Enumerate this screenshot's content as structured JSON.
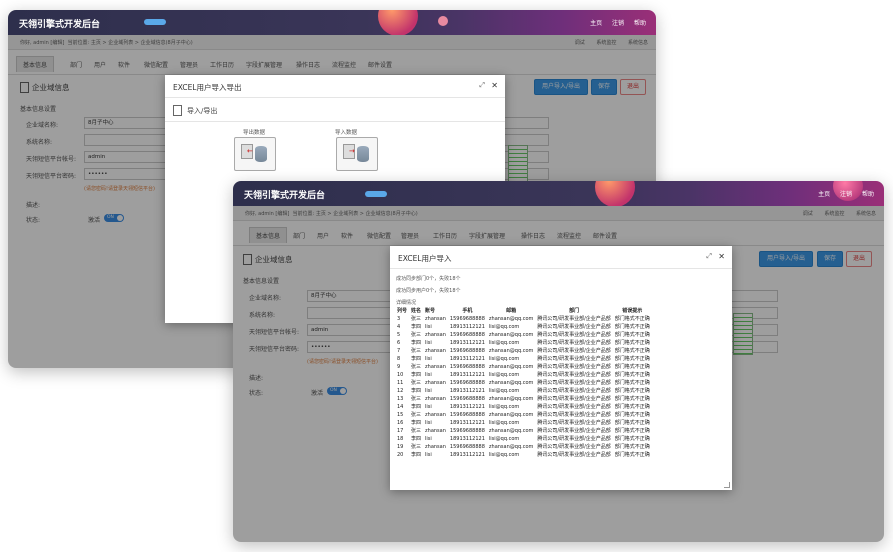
{
  "app": {
    "title": "天翎引擎式开发后台",
    "top_links": [
      "主页",
      "注销",
      "帮助"
    ]
  },
  "crumb": {
    "user": "你好, admin [编辑]",
    "location_label": "当前位置",
    "path": "主页 > 企业域列表 > 企业域信息(8月子中心)",
    "right_items": [
      "调试",
      "系统监控",
      "系统信息"
    ]
  },
  "tabs": [
    "基本信息",
    "部门",
    "用户",
    "软件",
    "微信配置",
    "管理员",
    "工作日历",
    "字段扩展管理",
    "操作日志",
    "流程监控",
    "邮件设置"
  ],
  "page": {
    "heading": "企业域信息",
    "section": "基本信息设置",
    "fields": [
      {
        "label": "企业域名称:",
        "value": "8月子中心"
      },
      {
        "label": "系统名称:",
        "value": ""
      },
      {
        "label": "天翎短信平台帐号:",
        "value": "admin"
      },
      {
        "label": "天翎短信平台密码:",
        "value": "••••••"
      }
    ],
    "warning": "(请您密码!请登录天翎短信平台)",
    "desc_label": "描述:",
    "status_label": "状态:",
    "status_value": "激活",
    "toggle": "ON",
    "buttons": {
      "import_export": "用户导入/导出",
      "save": "保存",
      "exit": "退出"
    }
  },
  "modal1": {
    "title": "EXCEL用户导入导出",
    "section": "导入/导出",
    "export_label": "导出数据",
    "import_label": "导入数据"
  },
  "modal2": {
    "title": "EXCEL用户导入",
    "success_dept": "成功同步部门0个，失败18个",
    "success_user": "成功同步用户0个，失败18个",
    "detail": "详细情况",
    "columns": [
      "列号",
      "姓名",
      "账号",
      "手机",
      "邮箱",
      "部门",
      "错误提示"
    ],
    "rows": [
      [
        "3",
        "张三",
        "zhansan",
        "15969688888",
        "zhansan@qq.com",
        "腾讯公司/研发事业部/企业产品部",
        "部门格式不正确"
      ],
      [
        "4",
        "李四",
        "lisi",
        "18913112121",
        "lisi@qq.com",
        "腾讯公司/研发事业部/企业产品部",
        "部门格式不正确"
      ],
      [
        "5",
        "张三",
        "zhansan",
        "15969688888",
        "zhansan@qq.com",
        "腾讯公司/研发事业部/企业产品部",
        "部门格式不正确"
      ],
      [
        "6",
        "李四",
        "lisi",
        "18913112121",
        "lisi@qq.com",
        "腾讯公司/研发事业部/企业产品部",
        "部门格式不正确"
      ],
      [
        "7",
        "张三",
        "zhansan",
        "15969688888",
        "zhansan@qq.com",
        "腾讯公司/研发事业部/企业产品部",
        "部门格式不正确"
      ],
      [
        "8",
        "李四",
        "lisi",
        "18913112121",
        "lisi@qq.com",
        "腾讯公司/研发事业部/企业产品部",
        "部门格式不正确"
      ],
      [
        "9",
        "张三",
        "zhansan",
        "15969688888",
        "zhansan@qq.com",
        "腾讯公司/研发事业部/企业产品部",
        "部门格式不正确"
      ],
      [
        "10",
        "李四",
        "lisi",
        "18913112121",
        "lisi@qq.com",
        "腾讯公司/研发事业部/企业产品部",
        "部门格式不正确"
      ],
      [
        "11",
        "张三",
        "zhansan",
        "15969688888",
        "zhansan@qq.com",
        "腾讯公司/研发事业部/企业产品部",
        "部门格式不正确"
      ],
      [
        "12",
        "李四",
        "lisi",
        "18913112121",
        "lisi@qq.com",
        "腾讯公司/研发事业部/企业产品部",
        "部门格式不正确"
      ],
      [
        "13",
        "张三",
        "zhansan",
        "15969688888",
        "zhansan@qq.com",
        "腾讯公司/研发事业部/企业产品部",
        "部门格式不正确"
      ],
      [
        "14",
        "李四",
        "lisi",
        "18913112121",
        "lisi@qq.com",
        "腾讯公司/研发事业部/企业产品部",
        "部门格式不正确"
      ],
      [
        "15",
        "张三",
        "zhansan",
        "15969688888",
        "zhansan@qq.com",
        "腾讯公司/研发事业部/企业产品部",
        "部门格式不正确"
      ],
      [
        "16",
        "李四",
        "lisi",
        "18913112121",
        "lisi@qq.com",
        "腾讯公司/研发事业部/企业产品部",
        "部门格式不正确"
      ],
      [
        "17",
        "张三",
        "zhansan",
        "15969688888",
        "zhansan@qq.com",
        "腾讯公司/研发事业部/企业产品部",
        "部门格式不正确"
      ],
      [
        "18",
        "李四",
        "lisi",
        "18913112121",
        "lisi@qq.com",
        "腾讯公司/研发事业部/企业产品部",
        "部门格式不正确"
      ],
      [
        "19",
        "张三",
        "zhansan",
        "15969688888",
        "zhansan@qq.com",
        "腾讯公司/研发事业部/企业产品部",
        "部门格式不正确"
      ],
      [
        "20",
        "李四",
        "lisi",
        "18913112121",
        "lisi@qq.com",
        "腾讯公司/研发事业部/企业产品部",
        "部门格式不正确"
      ]
    ]
  }
}
